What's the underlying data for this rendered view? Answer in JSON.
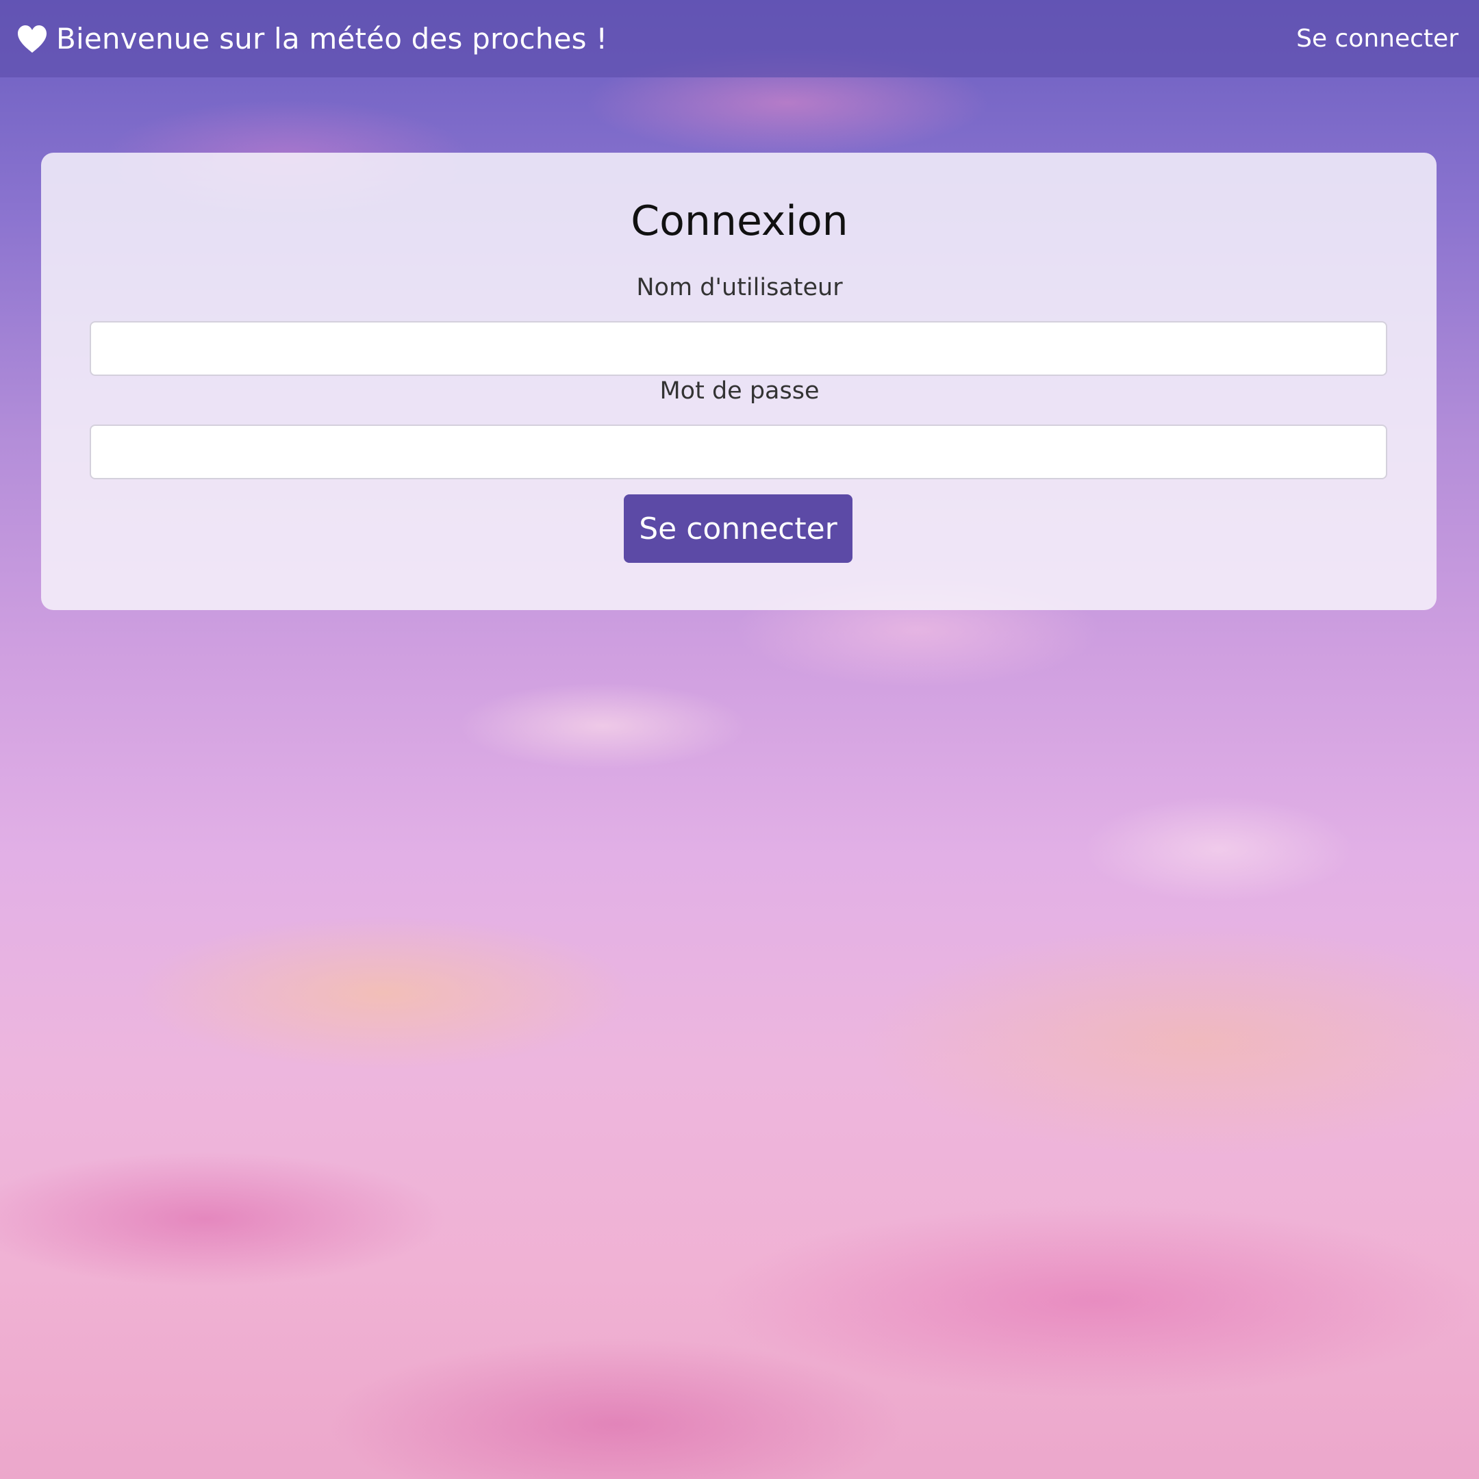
{
  "navbar": {
    "brand_icon": "heart-icon",
    "brand_text": "Bienvenue sur la météo des proches !",
    "login_link": "Se connecter",
    "background_color": "#5f50af"
  },
  "login_form": {
    "title": "Connexion",
    "username_label": "Nom d'utilisateur",
    "username_value": "",
    "password_label": "Mot de passe",
    "password_value": "",
    "submit_label": "Se connecter",
    "button_color": "#5c4aa6"
  }
}
